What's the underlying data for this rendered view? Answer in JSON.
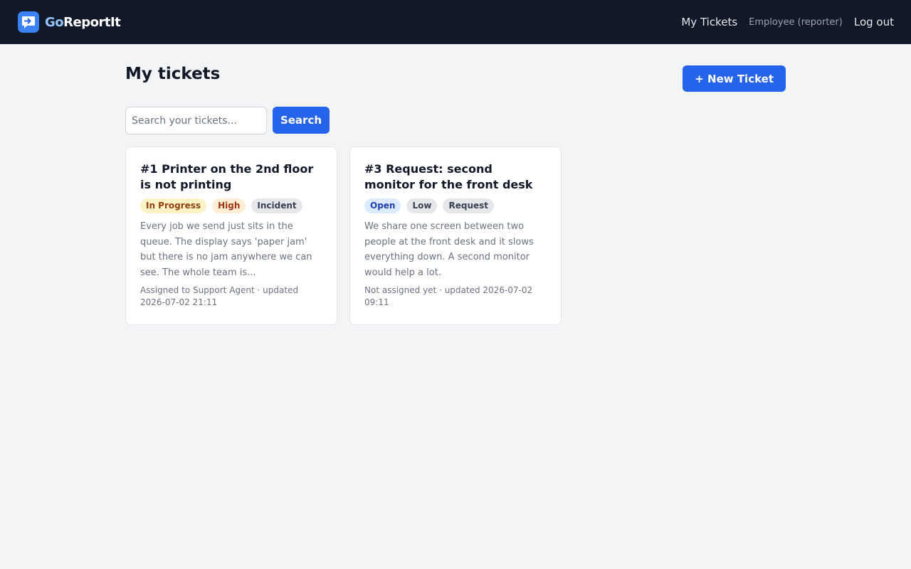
{
  "header": {
    "brand_go": "Go",
    "brand_rest": "ReportIt",
    "nav_my_tickets": "My Tickets",
    "user_label": "Employee (reporter)",
    "logout": "Log out"
  },
  "page": {
    "title": "My tickets",
    "new_ticket_label": "+ New Ticket"
  },
  "search": {
    "placeholder": "Search your tickets...",
    "value": "",
    "button_label": "Search"
  },
  "tickets": [
    {
      "title": "#1 Printer on the 2nd floor is not printing",
      "status": "In Progress",
      "priority": "High",
      "type": "Incident",
      "description": "Every job we send just sits in the queue. The display says 'paper jam' but there is no jam anywhere we can see. The whole team is...",
      "meta": "Assigned to Support Agent · updated 2026-07-02 21:11"
    },
    {
      "title": "#3 Request: second monitor for the front desk",
      "status": "Open",
      "priority": "Low",
      "type": "Request",
      "description": "We share one screen between two people at the front desk and it slows everything down. A second monitor would help a lot.",
      "meta": "Not assigned yet · updated 2026-07-02 09:11"
    }
  ],
  "colors": {
    "topbar": "#111827",
    "accent": "#2563eb",
    "page_bg": "#f3f4f6"
  },
  "icons": {
    "logo": "speech-bubble-arrow-icon"
  }
}
